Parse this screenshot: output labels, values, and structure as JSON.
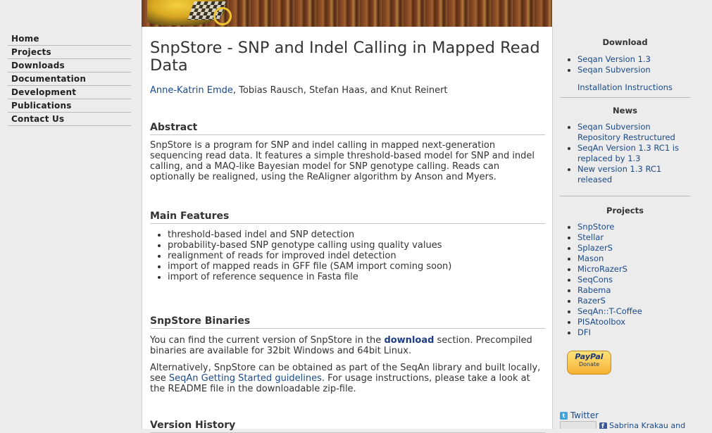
{
  "nav": {
    "items": [
      {
        "label": "Home"
      },
      {
        "label": "Projects"
      },
      {
        "label": "Downloads"
      },
      {
        "label": "Documentation"
      },
      {
        "label": "Development"
      },
      {
        "label": "Publications"
      },
      {
        "label": "Contact Us"
      }
    ]
  },
  "article": {
    "title": "SnpStore - SNP and Indel Calling in Mapped Read Data",
    "author_link": "Anne-Katrin Emde",
    "authors_rest": ", Tobias Rausch, Stefan Haas, and Knut Reinert",
    "abstract_heading": "Abstract",
    "abstract_text": "SnpStore is a program for SNP and indel calling in mapped next-generation sequencing read data. It features a simple threshold-based model for SNP and indel calling, and a MAQ-like Bayesian model for SNP genotype calling. Reads can optionally be realigned, using the ReAligner algorithm by Anson and Myers.",
    "features_heading": "Main Features",
    "features": [
      "threshold-based indel and SNP detection",
      "probability-based SNP genotype calling using quality values",
      "realignment of reads for improved indel detection",
      "import of mapped reads in GFF file (SAM import coming soon)",
      "import of reference sequence in Fasta file"
    ],
    "binaries_heading": "SnpStore Binaries",
    "binaries_p1_pre": "You can find the current version of SnpStore in the ",
    "binaries_p1_link": "download",
    "binaries_p1_post": " section. Precompiled binaries are available for 32bit Windows and 64bit Linux.",
    "binaries_p2_pre": "Alternatively, SnpStore can be obtained as part of the SeqAn library and built locally, see ",
    "binaries_p2_link": "SeqAn Getting Started guidelines",
    "binaries_p2_post": ". For usage instructions, please take a look at the README file in the downloadable zip-file.",
    "version_heading": "Version History"
  },
  "sidebar": {
    "download_heading": "Download",
    "download_items": [
      "Seqan Version 1.3",
      "Seqan Subversion"
    ],
    "install_link": "Installation Instructions",
    "news_heading": "News",
    "news_items": [
      "Seqan Subversion Repository Restructured",
      "SeqAn Version 1.3 RC1 is replaced by 1.3",
      "New version 1.3 RC1 released"
    ],
    "projects_heading": "Projects",
    "project_items": [
      "SnpStore",
      "Stellar",
      "SplazerS",
      "Mason",
      "MicroRazerS",
      "SeqCons",
      "Rabema",
      "RazerS",
      "SeqAn::T-Coffee",
      "PISAtoolbox",
      "DFI"
    ],
    "paypal_label": "PayPal",
    "paypal_sub": "Donate",
    "twitter_label": "Twitter",
    "facebook_text": "Sabrina Krakau and"
  },
  "icons": {
    "twitter": "twitter-icon",
    "facebook": "facebook-icon"
  },
  "colors": {
    "link": "#1a4a8a",
    "background": "#ececec",
    "content": "#ffffff"
  }
}
